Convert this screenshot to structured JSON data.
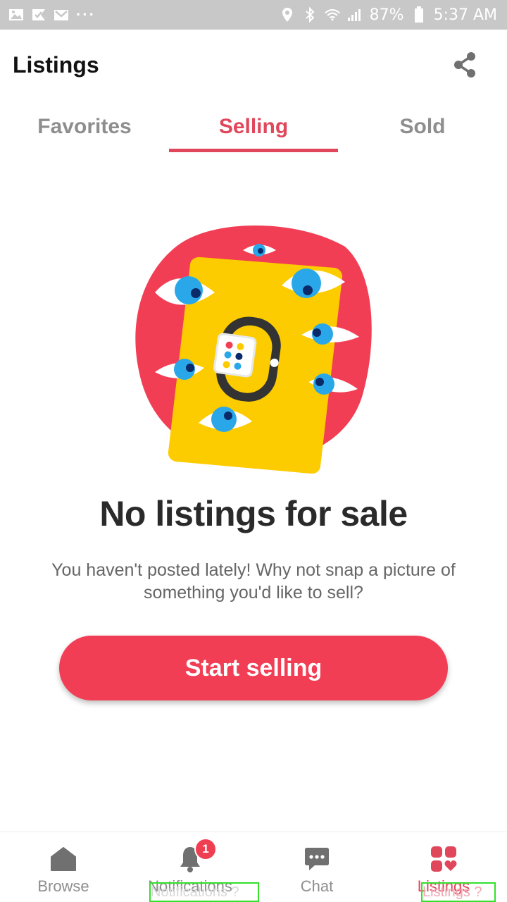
{
  "status_bar": {
    "battery": "87%",
    "time": "5:37 AM",
    "dots": "···"
  },
  "header": {
    "title": "Listings",
    "share_icon": "share-icon"
  },
  "tabs": [
    {
      "label": "Favorites",
      "active": false
    },
    {
      "label": "Selling",
      "active": true
    },
    {
      "label": "Sold",
      "active": false
    }
  ],
  "empty_state": {
    "title": "No listings for sale",
    "description": "You haven't posted lately! Why not snap a picture of something you'd like to sell?",
    "cta_label": "Start selling"
  },
  "bottom_nav": [
    {
      "label": "Browse",
      "icon": "home-icon",
      "active": false
    },
    {
      "label": "Notifications",
      "icon": "bell-icon",
      "active": false,
      "badge": "1"
    },
    {
      "label": "Chat",
      "icon": "chat-icon",
      "active": false
    },
    {
      "label": "Listings",
      "icon": "listings-icon",
      "active": true
    }
  ],
  "debug_labels": {
    "notifications": "Notifications ?",
    "listings": "Listings ?"
  },
  "colors": {
    "accent": "#e0475b",
    "cta": "#f23e55",
    "status_bar": "#c8c8c8",
    "inactive": "#8e8e8e"
  }
}
